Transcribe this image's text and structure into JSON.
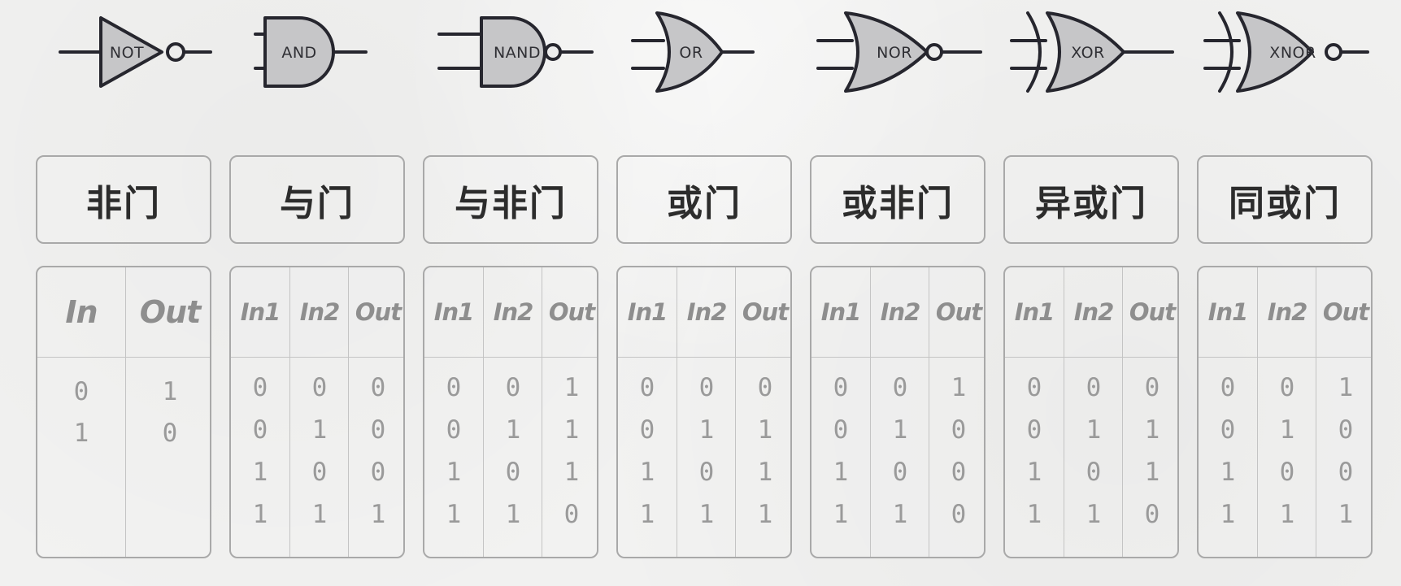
{
  "gates": [
    {
      "symbol": "NOT",
      "name": "非门",
      "headers": [
        "In",
        "Out"
      ],
      "rows": [
        [
          "0",
          "1"
        ],
        [
          "1",
          "0"
        ]
      ]
    },
    {
      "symbol": "AND",
      "name": "与门",
      "headers": [
        "In1",
        "In2",
        "Out"
      ],
      "rows": [
        [
          "0",
          "0",
          "0"
        ],
        [
          "0",
          "1",
          "0"
        ],
        [
          "1",
          "0",
          "0"
        ],
        [
          "1",
          "1",
          "1"
        ]
      ]
    },
    {
      "symbol": "NAND",
      "name": "与非门",
      "headers": [
        "In1",
        "In2",
        "Out"
      ],
      "rows": [
        [
          "0",
          "0",
          "1"
        ],
        [
          "0",
          "1",
          "1"
        ],
        [
          "1",
          "0",
          "1"
        ],
        [
          "1",
          "1",
          "0"
        ]
      ]
    },
    {
      "symbol": "OR",
      "name": "或门",
      "headers": [
        "In1",
        "In2",
        "Out"
      ],
      "rows": [
        [
          "0",
          "0",
          "0"
        ],
        [
          "0",
          "1",
          "1"
        ],
        [
          "1",
          "0",
          "1"
        ],
        [
          "1",
          "1",
          "1"
        ]
      ]
    },
    {
      "symbol": "NOR",
      "name": "或非门",
      "headers": [
        "In1",
        "In2",
        "Out"
      ],
      "rows": [
        [
          "0",
          "0",
          "1"
        ],
        [
          "0",
          "1",
          "0"
        ],
        [
          "1",
          "0",
          "0"
        ],
        [
          "1",
          "1",
          "0"
        ]
      ]
    },
    {
      "symbol": "XOR",
      "name": "异或门",
      "headers": [
        "In1",
        "In2",
        "Out"
      ],
      "rows": [
        [
          "0",
          "0",
          "0"
        ],
        [
          "0",
          "1",
          "1"
        ],
        [
          "1",
          "0",
          "1"
        ],
        [
          "1",
          "1",
          "0"
        ]
      ]
    },
    {
      "symbol": "XNOR",
      "name": "同或门",
      "headers": [
        "In1",
        "In2",
        "Out"
      ],
      "rows": [
        [
          "0",
          "0",
          "1"
        ],
        [
          "0",
          "1",
          "0"
        ],
        [
          "1",
          "0",
          "0"
        ],
        [
          "1",
          "1",
          "1"
        ]
      ]
    }
  ],
  "colors": {
    "gate_fill": "#c6c6c8",
    "gate_stroke": "#26262e",
    "header_text": "#8e8e8e",
    "value_text": "#9a9a9a",
    "title_text": "#2c2c2c"
  }
}
